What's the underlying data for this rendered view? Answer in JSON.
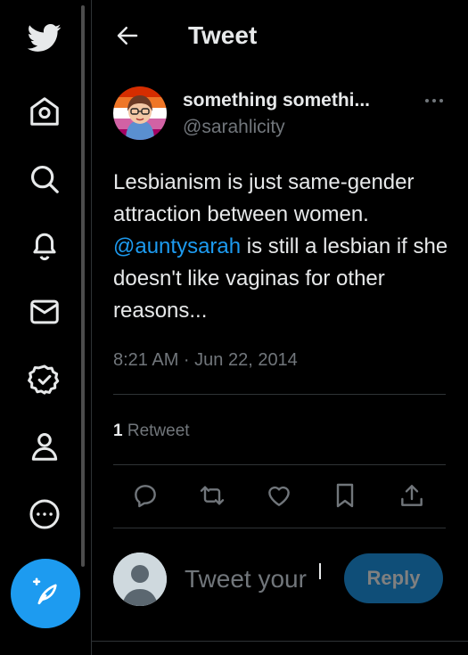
{
  "header": {
    "title": "Tweet"
  },
  "sidebar": {
    "items": [
      {
        "name": "twitter-logo-icon"
      },
      {
        "name": "home-icon"
      },
      {
        "name": "search-icon"
      },
      {
        "name": "notifications-bell-icon"
      },
      {
        "name": "messages-envelope-icon"
      },
      {
        "name": "verified-badge-icon"
      },
      {
        "name": "profile-person-icon"
      },
      {
        "name": "more-circle-icon"
      }
    ],
    "compose_icon": "compose-feather-icon"
  },
  "tweet": {
    "display_name": "something somethi...",
    "handle": "@sarahlicity",
    "text_part1": "Lesbianism is just same-gender attraction between women. ",
    "mention": "@auntysarah",
    "text_part2": " is still a lesbian if she doesn't like vaginas for other reasons...",
    "timestamp": "8:21 AM · Jun 22, 2014",
    "retweet_count": "1",
    "retweet_label": "Retweet"
  },
  "reply": {
    "placeholder": "Tweet your",
    "button_label": "Reply"
  },
  "colors": {
    "accent": "#1d9bf0",
    "background": "#000000",
    "muted_text": "#71767b",
    "reply_button_disabled": "#0f4e78"
  }
}
